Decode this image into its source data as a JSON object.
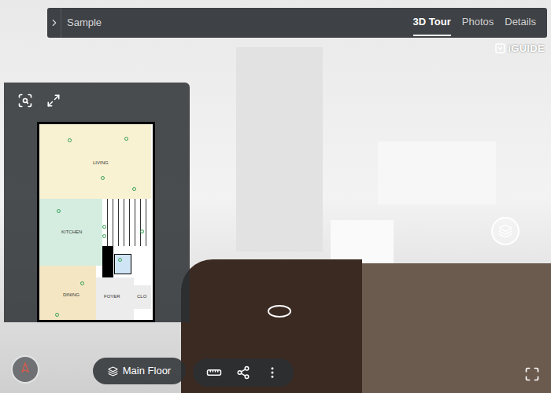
{
  "top_bar": {
    "title": "Sample",
    "tabs": [
      {
        "label": "3D Tour",
        "selected": true
      },
      {
        "label": "Photos",
        "selected": false
      },
      {
        "label": "Details",
        "selected": false
      }
    ]
  },
  "logo": {
    "text": "iGUIDE"
  },
  "floor_plan": {
    "rooms": [
      {
        "label": "LIVING"
      },
      {
        "label": "KITCHEN"
      },
      {
        "label": "DINING"
      },
      {
        "label": "FOYER"
      },
      {
        "label": "CLO"
      }
    ]
  },
  "floor_selector": {
    "label": "Main Floor"
  }
}
